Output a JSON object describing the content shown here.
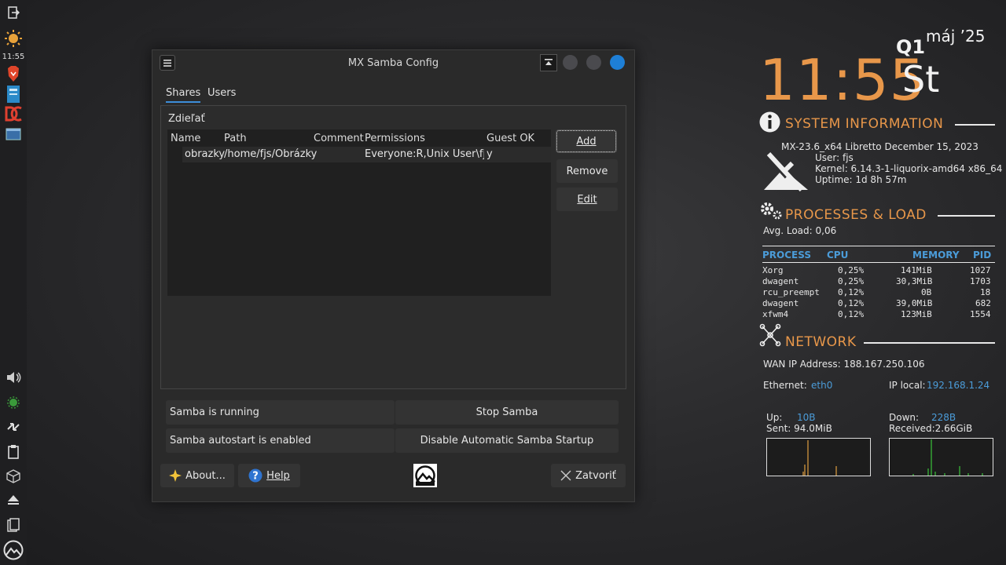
{
  "panel": {
    "clock": "11:55"
  },
  "window": {
    "title": "MX Samba Config",
    "tabs": [
      "Shares",
      "Users"
    ],
    "shares_label": "Zdieľať",
    "table": {
      "columns": [
        "Name",
        "Path",
        "Comment",
        "Permissions",
        "Guest OK"
      ],
      "rows": [
        {
          "name": "obrazky",
          "path": "/home/fjs/Obrázky",
          "comment": "",
          "permissions": "Everyone:R,Unix User\\fjs:F",
          "guest_ok": "y"
        }
      ]
    },
    "buttons": {
      "add": "Add",
      "remove": "Remove",
      "edit": "Edit"
    },
    "status": {
      "running": "Samba is running",
      "autostart": "Samba autostart is enabled",
      "stop": "Stop Samba",
      "disable_autostart": "Disable Automatic Samba Startup"
    },
    "bottom": {
      "about": "About...",
      "help": "Help",
      "close": "Zatvoriť"
    }
  },
  "conky": {
    "time": "11:55",
    "quarter": "Q1",
    "month_year": "máj ’25",
    "weekday": "St",
    "system_info": {
      "heading": "SYSTEM INFORMATION",
      "distro": "MX-23.6_x64 Libretto December 15, 2023",
      "user": "User: fjs",
      "kernel": "Kernel: 6.14.3-1-liquorix-amd64 x86_64",
      "uptime": "Uptime: 1d 8h 57m"
    },
    "processes": {
      "heading": "PROCESSES & LOAD",
      "avg_load": "Avg. Load: 0,06",
      "columns": [
        "PROCESS",
        "CPU",
        "MEMORY",
        "PID"
      ],
      "rows": [
        {
          "name": "Xorg",
          "cpu": "0,25%",
          "mem": "141MiB",
          "pid": "1027"
        },
        {
          "name": "dwagent",
          "cpu": "0,25%",
          "mem": "30,3MiB",
          "pid": "1703"
        },
        {
          "name": "rcu_preempt",
          "cpu": "0,12%",
          "mem": "0B",
          "pid": "18"
        },
        {
          "name": "dwagent",
          "cpu": "0,12%",
          "mem": "39,0MiB",
          "pid": "682"
        },
        {
          "name": "xfwm4",
          "cpu": "0,12%",
          "mem": "123MiB",
          "pid": "1554"
        }
      ]
    },
    "network": {
      "heading": "NETWORK",
      "wan": "WAN IP Address: 188.167.250.106",
      "eth_label": "Ethernet:",
      "eth_value": "eth0",
      "ip_label": "IP local:",
      "ip_value": "192.168.1.24",
      "up_label": "Up:",
      "up_value": "10B",
      "sent": "Sent: 94.0MiB",
      "down_label": "Down:",
      "down_value": "228B",
      "received": "Received:2.66GiB"
    },
    "colors": {
      "accent": "#e8974a",
      "highlight": "#4b9cd9"
    }
  }
}
